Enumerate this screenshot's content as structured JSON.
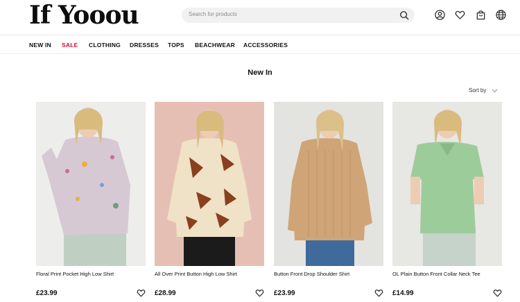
{
  "header": {
    "logo": "If Yooou",
    "search_placeholder": "Search for products"
  },
  "nav": [
    {
      "label": "NEW IN"
    },
    {
      "label": "SALE"
    },
    {
      "label": "CLOTHING"
    },
    {
      "label": "DRESSES"
    },
    {
      "label": "TOPS"
    },
    {
      "label": "BEACHWEAR"
    },
    {
      "label": "ACCESSORIES"
    }
  ],
  "page": {
    "title": "New In",
    "sort_label": "Sort by"
  },
  "products": [
    {
      "name": "Floral Print Pocket High Low Shirt",
      "price": "£23.99",
      "bg": "#ededeb",
      "shirt": "#d6c9d4",
      "accent": "#e8b23a",
      "pants": "#bfd0c2"
    },
    {
      "name": "All Over Print Button High Low Shirt",
      "price": "£28.99",
      "bg": "#e6bfb4",
      "shirt": "#efe2c6",
      "accent": "#8a3f1f",
      "pants": "#1b1b1b"
    },
    {
      "name": "Button Front Drop Shoulder Shirt",
      "price": "£23.99",
      "bg": "#e3e3e0",
      "shirt": "#cfa578",
      "accent": "#b98b5f",
      "pants": "#3f6a9c"
    },
    {
      "name": "OL Plain Button Front Collar Neck Tee",
      "price": "£14.99",
      "bg": "#e7e7e4",
      "shirt": "#9dcc9b",
      "accent": "#89b987",
      "pants": "#c6d3cb"
    }
  ],
  "colors": {
    "sale": "#c8102e",
    "text": "#111111"
  },
  "icons": [
    "search-icon",
    "account-icon",
    "heart-icon",
    "bag-icon",
    "globe-icon",
    "chevron-down-icon"
  ]
}
